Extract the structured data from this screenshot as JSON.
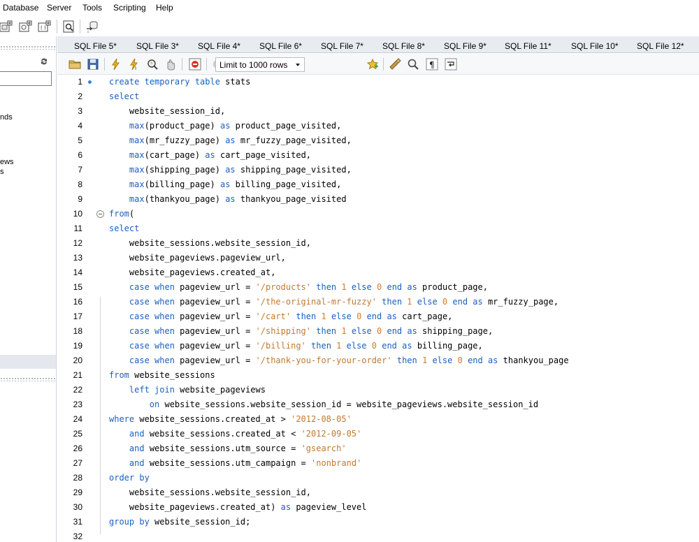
{
  "menubar": {
    "items": [
      "Database",
      "Server",
      "Tools",
      "Scripting",
      "Help"
    ]
  },
  "toolbar": {
    "icons": [
      "new-connection-icon",
      "manage-connections-icon",
      "add-schema-icon",
      "add-function-icon",
      "inspector-icon",
      "migration-icon"
    ]
  },
  "sidebar": {
    "filter_value": "",
    "items": [
      "nds",
      "ews",
      "s"
    ]
  },
  "tabs": [
    {
      "label": "SQL File 5*"
    },
    {
      "label": "SQL File 3*"
    },
    {
      "label": "SQL File 4*"
    },
    {
      "label": "SQL File 6*"
    },
    {
      "label": "SQL File 7*"
    },
    {
      "label": "SQL File 8*"
    },
    {
      "label": "SQL File 9*"
    },
    {
      "label": "SQL File 11*"
    },
    {
      "label": "SQL File 10*"
    },
    {
      "label": "SQL File 12*"
    }
  ],
  "editor_toolbar": {
    "limit_label": "Limit to 1000 rows"
  },
  "editor": {
    "lines": [
      {
        "num": "1",
        "segments": [
          [
            "k",
            "create temporary table"
          ],
          [
            "p",
            " stats"
          ]
        ]
      },
      {
        "num": "2",
        "segments": [
          [
            "k",
            "select"
          ]
        ]
      },
      {
        "num": "3",
        "segments": [
          [
            "p",
            "    website_session_id,"
          ]
        ]
      },
      {
        "num": "4",
        "segments": [
          [
            "p",
            "    "
          ],
          [
            "k",
            "max"
          ],
          [
            "p",
            "(product_page) "
          ],
          [
            "k",
            "as"
          ],
          [
            "p",
            " product_page_visited,"
          ]
        ]
      },
      {
        "num": "5",
        "segments": [
          [
            "p",
            "    "
          ],
          [
            "k",
            "max"
          ],
          [
            "p",
            "(mr_fuzzy_page) "
          ],
          [
            "k",
            "as"
          ],
          [
            "p",
            " mr_fuzzy_page_visited,"
          ]
        ]
      },
      {
        "num": "6",
        "segments": [
          [
            "p",
            "    "
          ],
          [
            "k",
            "max"
          ],
          [
            "p",
            "(cart_page) "
          ],
          [
            "k",
            "as"
          ],
          [
            "p",
            " cart_page_visited,"
          ]
        ]
      },
      {
        "num": "7",
        "segments": [
          [
            "p",
            "    "
          ],
          [
            "k",
            "max"
          ],
          [
            "p",
            "(shipping_page) "
          ],
          [
            "k",
            "as"
          ],
          [
            "p",
            " shipping_page_visited,"
          ]
        ]
      },
      {
        "num": "8",
        "segments": [
          [
            "p",
            "    "
          ],
          [
            "k",
            "max"
          ],
          [
            "p",
            "(billing_page) "
          ],
          [
            "k",
            "as"
          ],
          [
            "p",
            " billing_page_visited,"
          ]
        ]
      },
      {
        "num": "9",
        "segments": [
          [
            "p",
            "    "
          ],
          [
            "k",
            "max"
          ],
          [
            "p",
            "(thankyou_page) "
          ],
          [
            "k",
            "as"
          ],
          [
            "p",
            " thankyou_page_visited"
          ]
        ]
      },
      {
        "num": "10",
        "segments": [
          [
            "k",
            "from"
          ],
          [
            "p",
            "("
          ]
        ]
      },
      {
        "num": "11",
        "segments": [
          [
            "k",
            "select"
          ]
        ]
      },
      {
        "num": "12",
        "segments": [
          [
            "p",
            "    website_sessions.website_session_id,"
          ]
        ]
      },
      {
        "num": "13",
        "segments": [
          [
            "p",
            "    website_pageviews.pageview_url,"
          ]
        ]
      },
      {
        "num": "14",
        "segments": [
          [
            "p",
            "    website_pageviews.created_at,"
          ]
        ]
      },
      {
        "num": "15",
        "segments": [
          [
            "p",
            "    "
          ],
          [
            "k",
            "case when"
          ],
          [
            "p",
            " pageview_url = "
          ],
          [
            "s",
            "'/products'"
          ],
          [
            "p",
            " "
          ],
          [
            "k",
            "then"
          ],
          [
            "p",
            " "
          ],
          [
            "n",
            "1"
          ],
          [
            "p",
            " "
          ],
          [
            "k",
            "else"
          ],
          [
            "p",
            " "
          ],
          [
            "n",
            "0"
          ],
          [
            "p",
            " "
          ],
          [
            "k",
            "end as"
          ],
          [
            "p",
            " product_page,"
          ]
        ]
      },
      {
        "num": "16",
        "segments": [
          [
            "p",
            "    "
          ],
          [
            "k",
            "case when"
          ],
          [
            "p",
            " pageview_url = "
          ],
          [
            "s",
            "'/the-original-mr-fuzzy'"
          ],
          [
            "p",
            " "
          ],
          [
            "k",
            "then"
          ],
          [
            "p",
            " "
          ],
          [
            "n",
            "1"
          ],
          [
            "p",
            " "
          ],
          [
            "k",
            "else"
          ],
          [
            "p",
            " "
          ],
          [
            "n",
            "0"
          ],
          [
            "p",
            " "
          ],
          [
            "k",
            "end as"
          ],
          [
            "p",
            " mr_fuzzy_page,"
          ]
        ]
      },
      {
        "num": "17",
        "segments": [
          [
            "p",
            "    "
          ],
          [
            "k",
            "case when"
          ],
          [
            "p",
            " pageview_url = "
          ],
          [
            "s",
            "'/cart'"
          ],
          [
            "p",
            " "
          ],
          [
            "k",
            "then"
          ],
          [
            "p",
            " "
          ],
          [
            "n",
            "1"
          ],
          [
            "p",
            " "
          ],
          [
            "k",
            "else"
          ],
          [
            "p",
            " "
          ],
          [
            "n",
            "0"
          ],
          [
            "p",
            " "
          ],
          [
            "k",
            "end as"
          ],
          [
            "p",
            " cart_page,"
          ]
        ]
      },
      {
        "num": "18",
        "segments": [
          [
            "p",
            "    "
          ],
          [
            "k",
            "case when"
          ],
          [
            "p",
            " pageview_url = "
          ],
          [
            "s",
            "'/shipping'"
          ],
          [
            "p",
            " "
          ],
          [
            "k",
            "then"
          ],
          [
            "p",
            " "
          ],
          [
            "n",
            "1"
          ],
          [
            "p",
            " "
          ],
          [
            "k",
            "else"
          ],
          [
            "p",
            " "
          ],
          [
            "n",
            "0"
          ],
          [
            "p",
            " "
          ],
          [
            "k",
            "end as"
          ],
          [
            "p",
            " shipping_page,"
          ]
        ]
      },
      {
        "num": "19",
        "segments": [
          [
            "p",
            "    "
          ],
          [
            "k",
            "case when"
          ],
          [
            "p",
            " pageview_url = "
          ],
          [
            "s",
            "'/billing'"
          ],
          [
            "p",
            " "
          ],
          [
            "k",
            "then"
          ],
          [
            "p",
            " "
          ],
          [
            "n",
            "1"
          ],
          [
            "p",
            " "
          ],
          [
            "k",
            "else"
          ],
          [
            "p",
            " "
          ],
          [
            "n",
            "0"
          ],
          [
            "p",
            " "
          ],
          [
            "k",
            "end as"
          ],
          [
            "p",
            " billing_page,"
          ]
        ]
      },
      {
        "num": "20",
        "segments": [
          [
            "p",
            "    "
          ],
          [
            "k",
            "case when"
          ],
          [
            "p",
            " pageview_url = "
          ],
          [
            "s",
            "'/thank-you-for-your-order'"
          ],
          [
            "p",
            " "
          ],
          [
            "k",
            "then"
          ],
          [
            "p",
            " "
          ],
          [
            "n",
            "1"
          ],
          [
            "p",
            " "
          ],
          [
            "k",
            "else"
          ],
          [
            "p",
            " "
          ],
          [
            "n",
            "0"
          ],
          [
            "p",
            " "
          ],
          [
            "k",
            "end as"
          ],
          [
            "p",
            " thankyou_page"
          ]
        ]
      },
      {
        "num": "21",
        "segments": [
          [
            "k",
            "from"
          ],
          [
            "p",
            " website_sessions"
          ]
        ]
      },
      {
        "num": "22",
        "segments": [
          [
            "p",
            "    "
          ],
          [
            "k",
            "left join"
          ],
          [
            "p",
            " website_pageviews"
          ]
        ]
      },
      {
        "num": "23",
        "segments": [
          [
            "p",
            "        "
          ],
          [
            "k",
            "on"
          ],
          [
            "p",
            " website_sessions.website_session_id = website_pageviews.website_session_id"
          ]
        ]
      },
      {
        "num": "24",
        "segments": [
          [
            "k",
            "where"
          ],
          [
            "p",
            " website_sessions.created_at > "
          ],
          [
            "s",
            "'2012-08-05'"
          ]
        ]
      },
      {
        "num": "25",
        "segments": [
          [
            "p",
            "    "
          ],
          [
            "k",
            "and"
          ],
          [
            "p",
            " website_sessions.created_at < "
          ],
          [
            "s",
            "'2012-09-05'"
          ]
        ]
      },
      {
        "num": "26",
        "segments": [
          [
            "p",
            "    "
          ],
          [
            "k",
            "and"
          ],
          [
            "p",
            " website_sessions.utm_source = "
          ],
          [
            "s",
            "'gsearch'"
          ]
        ]
      },
      {
        "num": "27",
        "segments": [
          [
            "p",
            "    "
          ],
          [
            "k",
            "and"
          ],
          [
            "p",
            " website_sessions.utm_campaign = "
          ],
          [
            "s",
            "'nonbrand'"
          ]
        ]
      },
      {
        "num": "28",
        "segments": [
          [
            "k",
            "order by"
          ]
        ]
      },
      {
        "num": "29",
        "segments": [
          [
            "p",
            "    website_sessions.website_session_id,"
          ]
        ]
      },
      {
        "num": "30",
        "segments": [
          [
            "p",
            "    website_pageviews.created_at) "
          ],
          [
            "k",
            "as"
          ],
          [
            "p",
            " pageview_level"
          ]
        ]
      },
      {
        "num": "31",
        "segments": [
          [
            "k",
            "group by"
          ],
          [
            "p",
            " website_session_id;"
          ]
        ]
      },
      {
        "num": "32",
        "segments": []
      }
    ]
  }
}
